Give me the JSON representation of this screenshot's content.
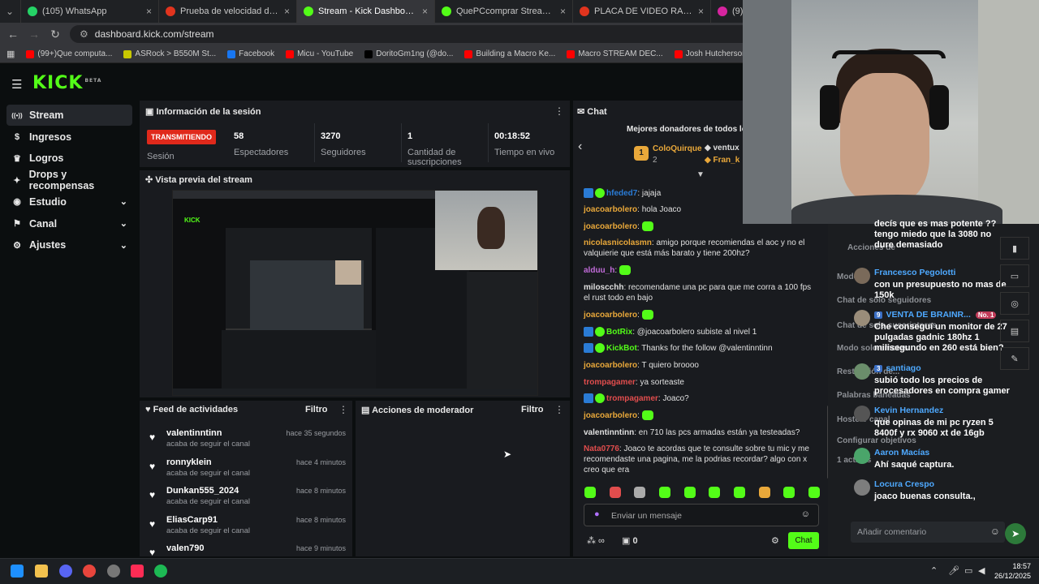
{
  "browser": {
    "tabs": [
      {
        "title": "(105) WhatsApp",
        "color": "#25d366",
        "active": false
      },
      {
        "title": "Prueba de velocidad de Interne",
        "color": "#e1341e",
        "active": false
      },
      {
        "title": "Stream - Kick Dashboard",
        "color": "#53fc18",
        "active": true
      },
      {
        "title": "QuePCcomprar Stream - Watc",
        "color": "#53fc18",
        "active": false
      },
      {
        "title": "PLACA DE VIDEO RADEON RX",
        "color": "#e1341e",
        "active": false
      },
      {
        "title": "(9) Instagram",
        "color": "#d6249f",
        "active": false
      }
    ],
    "url": "dashboard.kick.com/stream",
    "bookmarks": [
      {
        "label": "(99+)Que computa...",
        "color": "#ff0000"
      },
      {
        "label": "ASRock > B550M St...",
        "color": "#c8c800"
      },
      {
        "label": "Facebook",
        "color": "#1877f2"
      },
      {
        "label": "Micu - YouTube",
        "color": "#ff0000"
      },
      {
        "label": "DoritoGm1ng (@do...",
        "color": "#000000"
      },
      {
        "label": "Building a Macro Ke...",
        "color": "#ff0000"
      },
      {
        "label": "Macro STREAM DEC...",
        "color": "#ff0000"
      },
      {
        "label": "Josh Hutcherson ||...",
        "color": "#ff0000"
      },
      {
        "label": "jot4 (@jot4op) | Tik...",
        "color": "#000000"
      }
    ]
  },
  "kick": {
    "logo": "KICK",
    "logo_tag": "BETA",
    "sidebar": [
      {
        "label": "Stream",
        "icon": "broadcast-icon",
        "active": true,
        "chevron": false
      },
      {
        "label": "Ingresos",
        "icon": "money-icon",
        "active": false,
        "chevron": false
      },
      {
        "label": "Logros",
        "icon": "trophy-icon",
        "active": false,
        "chevron": false
      },
      {
        "label": "Drops y recompensas",
        "icon": "gift-icon",
        "active": false,
        "chevron": false
      },
      {
        "label": "Estudio",
        "icon": "studio-icon",
        "active": false,
        "chevron": true
      },
      {
        "label": "Canal",
        "icon": "channel-icon",
        "active": false,
        "chevron": true
      },
      {
        "label": "Ajustes",
        "icon": "gear-icon",
        "active": false,
        "chevron": true
      }
    ],
    "session": {
      "title": "Información de la sesión",
      "live_badge": "TRANSMITIENDO",
      "session_label": "Sesión",
      "stats": [
        {
          "value": "58",
          "label": "Espectadores"
        },
        {
          "value": "3270",
          "label": "Seguidores"
        },
        {
          "value": "1",
          "label": "Cantidad de suscripciones"
        },
        {
          "value": "00:18:52",
          "label": "Tiempo en vivo"
        }
      ]
    },
    "preview": {
      "title": "Vista previa del stream"
    },
    "feed": {
      "title": "Feed de actividades",
      "filter": "Filtro",
      "items": [
        {
          "user": "valentinntinn",
          "text": "acaba de seguir el canal",
          "time": "hace 35 segundos"
        },
        {
          "user": "ronnyklein",
          "text": "acaba de seguir el canal",
          "time": "hace 4 minutos"
        },
        {
          "user": "Dunkan555_2024",
          "text": "acaba de seguir el canal",
          "time": "hace 8 minutos"
        },
        {
          "user": "EliasCarp91",
          "text": "acaba de seguir el canal",
          "time": "hace 8 minutos"
        },
        {
          "user": "valen790",
          "text": "",
          "time": "hace 9 minutos"
        }
      ]
    },
    "moderator": {
      "title": "Acciones de moderador",
      "filter": "Filtro"
    },
    "chat": {
      "title": "Chat",
      "donors_title": "Mejores donadores de todos los",
      "donor1": {
        "rank": "1",
        "name": "ColoQuirque",
        "amount": "2"
      },
      "donor2": {
        "name": "ventux"
      },
      "donor3": {
        "name": "Fran_k"
      },
      "messages": [
        {
          "user": "hfeded7",
          "color": "#2a7bd5",
          "text": "jajaja",
          "badge": true
        },
        {
          "user": "joacoarbolero",
          "color": "#e9a83a",
          "text": "hola Joaco"
        },
        {
          "user": "joacoarbolero",
          "color": "#e9a83a",
          "text": "",
          "emote": true
        },
        {
          "user": "nicolasnicolasmn",
          "color": "#e9a83a",
          "text": "amigo porque recomiendas el aoc y no el valquierie que está más barato y tiene 200hz?"
        },
        {
          "user": "alduu_h",
          "color": "#c06bd8",
          "text": "",
          "emote": true
        },
        {
          "user": "miloscchh",
          "color": "#e0e0e0",
          "text": "recomendame una pc para que me corra a 100 fps el rust todo en bajo"
        },
        {
          "user": "joacoarbolero",
          "color": "#e9a83a",
          "text": "",
          "emote": true
        },
        {
          "user": "BotRix",
          "color": "#53fc18",
          "text": "@joacoarbolero subiste al nivel 1",
          "badge": true
        },
        {
          "user": "KickBot",
          "color": "#53fc18",
          "text": "Thanks for the follow @valentinntinn",
          "badge": true
        },
        {
          "user": "joacoarbolero",
          "color": "#e9a83a",
          "text": "T quiero broooo"
        },
        {
          "user": "trompagamer",
          "color": "#e14d4d",
          "text": "ya sorteaste"
        },
        {
          "user": "trompagamer",
          "color": "#e14d4d",
          "text": "Joaco?",
          "badge": true
        },
        {
          "user": "joacoarbolero",
          "color": "#e9a83a",
          "text": "",
          "emote": true
        },
        {
          "user": "valentinntinn",
          "color": "#e0e0e0",
          "text": "en 710 las pcs armadas están ya testeadas?"
        },
        {
          "user": "Nata0776",
          "color": "#e14d4d",
          "text": "Joaco te acordas que te consulte sobre tu mic y me recomendaste una pagina, me la podrias recordar? algo con x creo que era"
        }
      ],
      "input_placeholder": "Enviar un mensaje",
      "points": "0",
      "send_label": "Chat"
    }
  },
  "overlay": {
    "messages": [
      {
        "name": "",
        "text": "decís que es mas potente ?? tengo miedo que la 3080 no dure demasiado"
      },
      {
        "name": "Francesco Pegolotti",
        "text": "con un presupuesto no mas de 150k"
      },
      {
        "name": "VENTA DE BRAINR...",
        "text": "Che conseguí un monitor de 27 pulgadas gadnic 180hz 1 milisegundo en 260 está bien?",
        "badge": "No. 1",
        "count": "9"
      },
      {
        "name": "santiago",
        "text": "subió todo los precios de procesadores en compra gamer",
        "count": "3"
      },
      {
        "name": "Kevin Hernandez",
        "text": "que opinas de mi pc ryzen 5 8400f y rx 9060 xt de 16gb"
      },
      {
        "name": "Aaron Macías",
        "text": "Ahí saqué captura."
      },
      {
        "name": "Locura Crespo",
        "text": "joaco buenas consulta.,"
      }
    ],
    "comment_placeholder": "Añadir comentario",
    "ghost_labels": [
      "Acciones de",
      "Modo ...",
      "Chat de solo seguidores",
      "Chat de solo suscriptores",
      "Modo solo emotes",
      "Restricción de...",
      "Palabras baneadas",
      "Hostear canal",
      "Configurar objetivos",
      "1 activas"
    ]
  },
  "taskbar": {
    "time": "18:57",
    "date": "26/12/2025"
  }
}
